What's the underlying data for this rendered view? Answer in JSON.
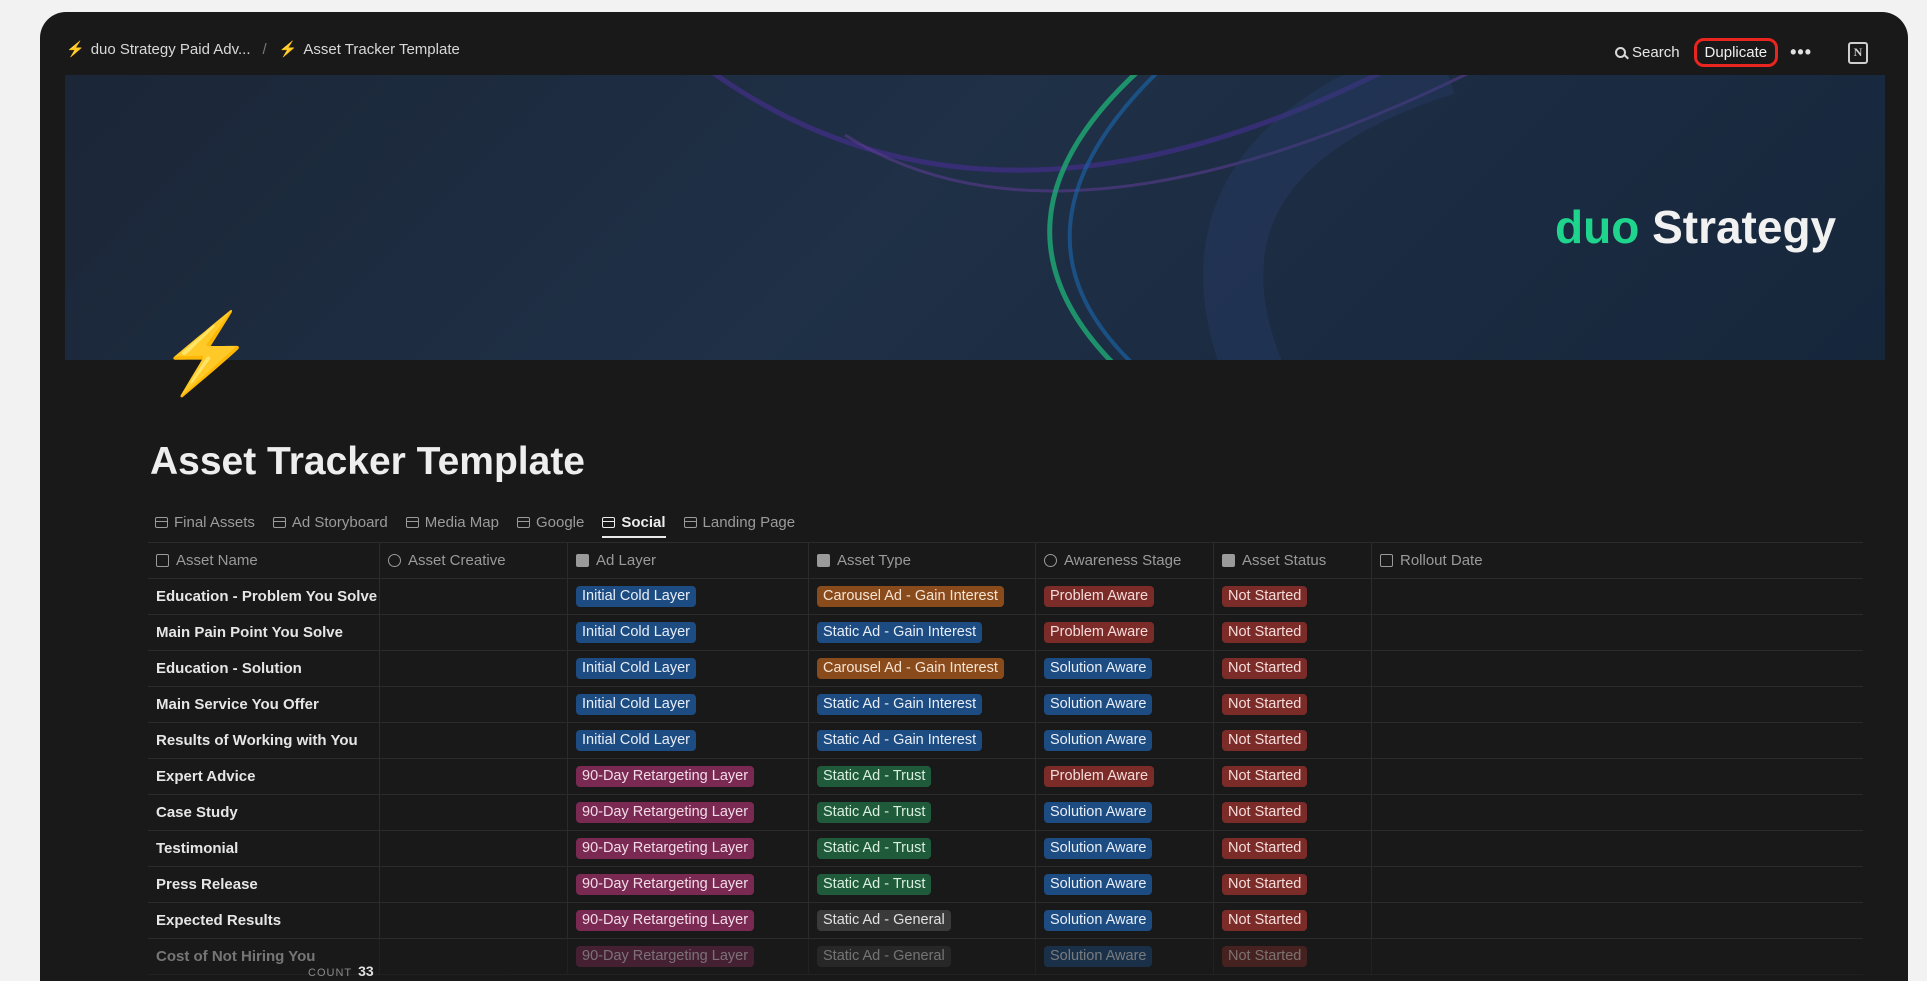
{
  "breadcrumbs": [
    "duo Strategy Paid Adv...",
    "Asset Tracker Template"
  ],
  "top_actions": {
    "search_label": "Search",
    "duplicate_label": "Duplicate",
    "more_label": "•••",
    "notion_label": "N"
  },
  "cover": {
    "brand_accent": "duo",
    "brand_rest": " Strategy"
  },
  "page_icon": "⚡",
  "page_title": "Asset Tracker Template",
  "tabs": [
    {
      "label": "Final Assets",
      "active": false
    },
    {
      "label": "Ad Storyboard",
      "active": false
    },
    {
      "label": "Media Map",
      "active": false
    },
    {
      "label": "Google",
      "active": false
    },
    {
      "label": "Social",
      "active": true
    },
    {
      "label": "Landing Page",
      "active": false
    }
  ],
  "columns": [
    "Asset Name",
    "Asset Creative",
    "Ad Layer",
    "Asset Type",
    "Awareness Stage",
    "Asset Status",
    "Rollout Date"
  ],
  "rows": [
    {
      "name": "Education - Problem You Solve",
      "layer": "Initial Cold Layer",
      "type": "Carousel Ad - Gain Interest",
      "stage": "Problem Aware",
      "status": "Not Started"
    },
    {
      "name": "Main Pain Point You Solve",
      "layer": "Initial Cold Layer",
      "type": "Static Ad - Gain Interest",
      "stage": "Problem Aware",
      "status": "Not Started"
    },
    {
      "name": "Education - Solution",
      "layer": "Initial Cold Layer",
      "type": "Carousel Ad - Gain Interest",
      "stage": "Solution Aware",
      "status": "Not Started"
    },
    {
      "name": "Main Service You Offer",
      "layer": "Initial Cold Layer",
      "type": "Static Ad - Gain Interest",
      "stage": "Solution Aware",
      "status": "Not Started"
    },
    {
      "name": "Results of Working with You",
      "layer": "Initial Cold Layer",
      "type": "Static Ad - Gain Interest",
      "stage": "Solution Aware",
      "status": "Not Started"
    },
    {
      "name": "Expert Advice",
      "layer": "90-Day Retargeting Layer",
      "type": "Static Ad - Trust",
      "stage": "Problem Aware",
      "status": "Not Started"
    },
    {
      "name": "Case Study",
      "layer": "90-Day Retargeting Layer",
      "type": "Static Ad - Trust",
      "stage": "Solution Aware",
      "status": "Not Started"
    },
    {
      "name": "Testimonial",
      "layer": "90-Day Retargeting Layer",
      "type": "Static Ad - Trust",
      "stage": "Solution Aware",
      "status": "Not Started"
    },
    {
      "name": "Press Release",
      "layer": "90-Day Retargeting Layer",
      "type": "Static Ad - Trust",
      "stage": "Solution Aware",
      "status": "Not Started"
    },
    {
      "name": "Expected Results",
      "layer": "90-Day Retargeting Layer",
      "type": "Static Ad - General",
      "stage": "Solution Aware",
      "status": "Not Started"
    },
    {
      "name": "Cost of Not Hiring You",
      "layer": "90-Day Retargeting Layer",
      "type": "Static Ad - General",
      "stage": "Solution Aware",
      "status": "Not Started"
    }
  ],
  "footer": {
    "count_label": "COUNT",
    "count_value": "33"
  },
  "colors": {
    "background": "#191919",
    "accent_red": "#e8261f",
    "brand_green": "#1fd48c"
  }
}
